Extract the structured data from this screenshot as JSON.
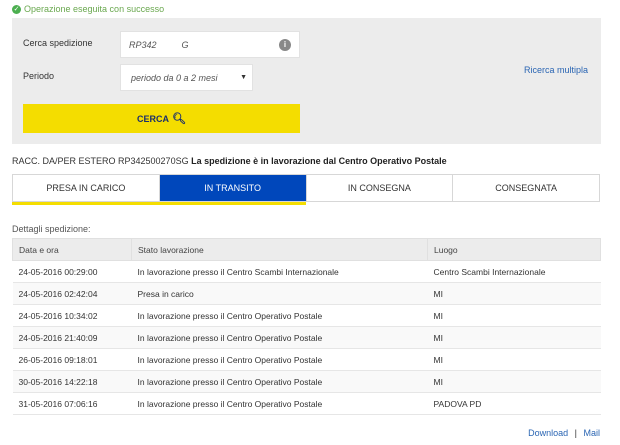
{
  "notice": {
    "text": "Operazione eseguita con successo"
  },
  "search": {
    "track_label": "Cerca spedizione",
    "track_value": "RP342          G",
    "period_label": "Periodo",
    "period_value": "periodo da 0 a 2 mesi",
    "multi_link": "Ricerca multipla",
    "button_label": "CERCA"
  },
  "shipment": {
    "code_line": "RACC. DA/PER ESTERO RP342500270SG",
    "status_message": "La spedizione è in lavorazione dal Centro Operativo Postale"
  },
  "steps": [
    "PRESA IN CARICO",
    "IN TRANSITO",
    "IN CONSEGNA",
    "CONSEGNATA"
  ],
  "active_step": "IN TRANSITO",
  "details": {
    "title": "Dettagli spedizione:",
    "headers": [
      "Data e ora",
      "Stato lavorazione",
      "Luogo"
    ],
    "rows": [
      [
        "24-05-2016 00:29:00",
        "In lavorazione presso il Centro Scambi Internazionale",
        "Centro Scambi Internazionale"
      ],
      [
        "24-05-2016 02:42:04",
        "Presa in carico",
        "MI"
      ],
      [
        "24-05-2016 10:34:02",
        "In lavorazione presso il Centro Operativo Postale",
        "MI"
      ],
      [
        "24-05-2016 21:40:09",
        "In lavorazione presso il Centro Operativo Postale",
        "MI"
      ],
      [
        "26-05-2016 09:18:01",
        "In lavorazione presso il Centro Operativo Postale",
        "MI"
      ],
      [
        "30-05-2016 14:22:18",
        "In lavorazione presso il Centro Operativo Postale",
        "MI"
      ],
      [
        "31-05-2016 07:06:16",
        "In lavorazione presso il Centro Operativo Postale",
        "PADOVA PD"
      ]
    ]
  },
  "footer": {
    "download": "Download",
    "separator": "|",
    "mail": "Mail"
  },
  "icons": {
    "success": "check-circle-icon",
    "info": "info-icon",
    "dropdown": "caret-down-icon",
    "search": "magnifier-icon"
  },
  "colors": {
    "accent_yellow": "#f4dd00",
    "active_blue": "#0047bb",
    "link_blue": "#2a65b3",
    "success_green": "#4caf50"
  }
}
